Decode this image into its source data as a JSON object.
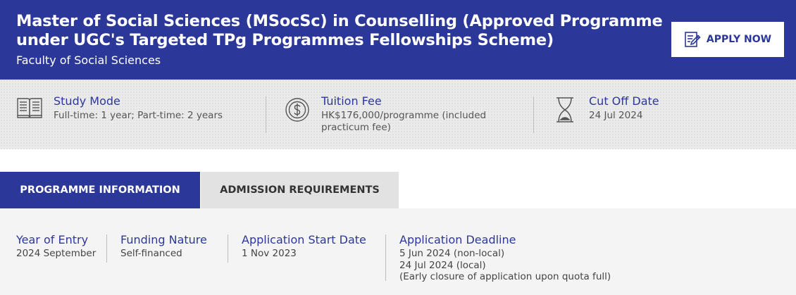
{
  "header": {
    "title": "Master of Social Sciences (MSocSc) in Counselling (Approved Programme under UGC's Targeted TPg Programmes Fellowships Scheme)",
    "faculty": "Faculty of Social Sciences",
    "apply_label": "APPLY NOW",
    "apply_icon": "edit-form-icon"
  },
  "info": {
    "study_mode": {
      "icon": "book-icon",
      "title": "Study Mode",
      "value": "Full-time: 1 year; Part-time: 2 years"
    },
    "tuition_fee": {
      "icon": "dollar-coin-icon",
      "title": "Tuition Fee",
      "value": "HK$176,000/programme (included practicum fee)"
    },
    "cut_off": {
      "icon": "hourglass-icon",
      "title": "Cut Off Date",
      "value": "24 Jul 2024"
    }
  },
  "tabs": [
    {
      "label": "PROGRAMME INFORMATION",
      "active": true
    },
    {
      "label": "ADMISSION REQUIREMENTS",
      "active": false
    }
  ],
  "details": {
    "year_of_entry": {
      "title": "Year of Entry",
      "value": "2024 September"
    },
    "funding_nature": {
      "title": "Funding Nature",
      "value": "Self-financed"
    },
    "application_start": {
      "title": "Application Start Date",
      "value": "1 Nov 2023"
    },
    "application_deadline": {
      "title": "Application Deadline",
      "lines": [
        "5 Jun 2024 (non-local)",
        "24 Jul 2024 (local)",
        "(Early closure of application upon quota full)"
      ]
    }
  },
  "colors": {
    "brand_blue": "#2c3899",
    "info_bar_bg": "#ebebeb",
    "inactive_tab_bg": "#e2e2e2",
    "details_bg": "#f4f4f4"
  }
}
